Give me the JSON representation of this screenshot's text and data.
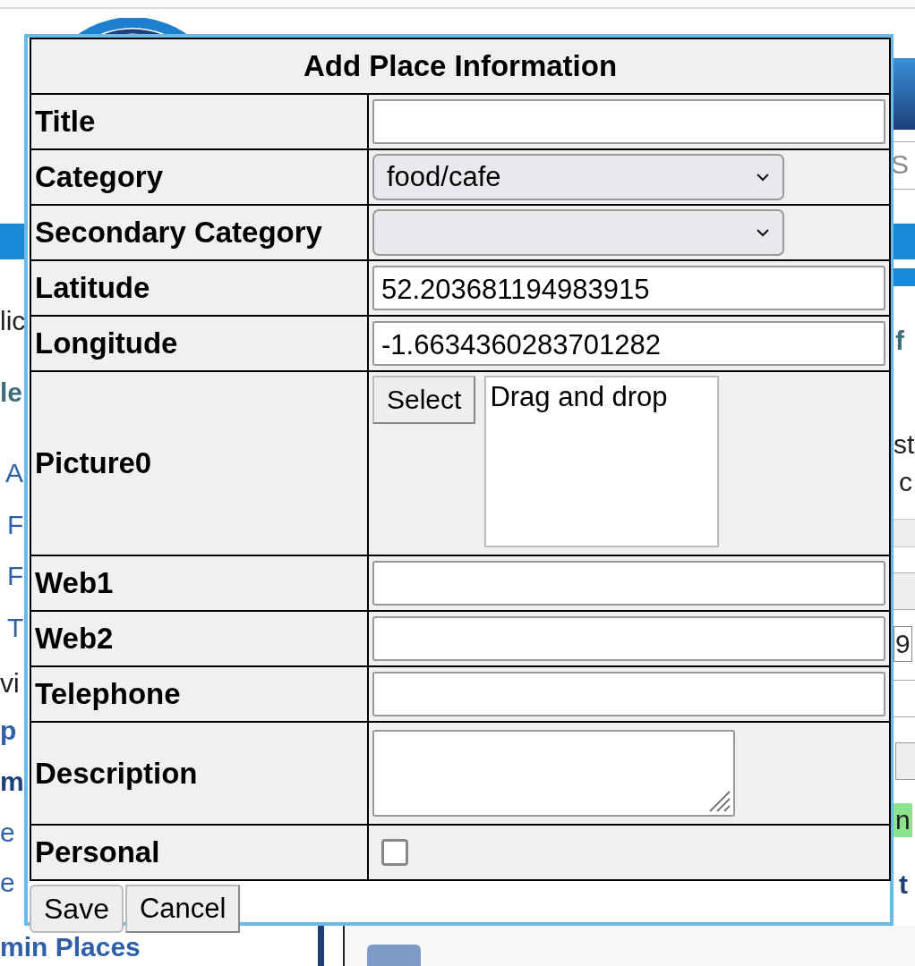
{
  "background": {
    "search_placeholder": "S",
    "left_fragments": [
      {
        "text": "lic",
        "kind": "text"
      },
      {
        "text": "le",
        "kind": "heading"
      },
      {
        "text": "A",
        "kind": "link"
      },
      {
        "text": "F",
        "kind": "link"
      },
      {
        "text": "F",
        "kind": "link"
      },
      {
        "text": "T",
        "kind": "link"
      },
      {
        "text": "vi",
        "kind": "text"
      },
      {
        "text": "p",
        "kind": "bold-link"
      },
      {
        "text": "m",
        "kind": "bold-text"
      },
      {
        "text": "e",
        "kind": "link"
      },
      {
        "text": "e",
        "kind": "link"
      },
      {
        "text": "min Places",
        "kind": "bold-link"
      }
    ],
    "right_fragments": [
      {
        "text": "f",
        "kind": "heading"
      },
      {
        "text": "st",
        "kind": "text"
      },
      {
        "text": "c",
        "kind": "text"
      },
      {
        "text": "9",
        "kind": "field"
      },
      {
        "text": "n",
        "kind": "badge"
      },
      {
        "text": "t",
        "kind": "bold-text"
      }
    ]
  },
  "dialog": {
    "title": "Add Place Information",
    "fields": [
      {
        "label": "Title",
        "kind": "text"
      },
      {
        "label": "Category",
        "kind": "select",
        "value": "food/cafe"
      },
      {
        "label": "Secondary Category",
        "kind": "select"
      },
      {
        "label": "Latitude",
        "kind": "text",
        "value": "52.203681194983915"
      },
      {
        "label": "Longitude",
        "kind": "text",
        "value": "-1.6634360283701282"
      },
      {
        "label": "Picture0",
        "kind": "file",
        "button": "Select",
        "drop_text": "Drag and drop"
      },
      {
        "label": "Web1",
        "kind": "text"
      },
      {
        "label": "Web2",
        "kind": "text"
      },
      {
        "label": "Telephone",
        "kind": "text"
      },
      {
        "label": "Description",
        "kind": "textarea"
      },
      {
        "label": "Personal",
        "kind": "checkbox",
        "checked": false
      }
    ],
    "buttons": [
      "Save",
      "Cancel"
    ]
  }
}
